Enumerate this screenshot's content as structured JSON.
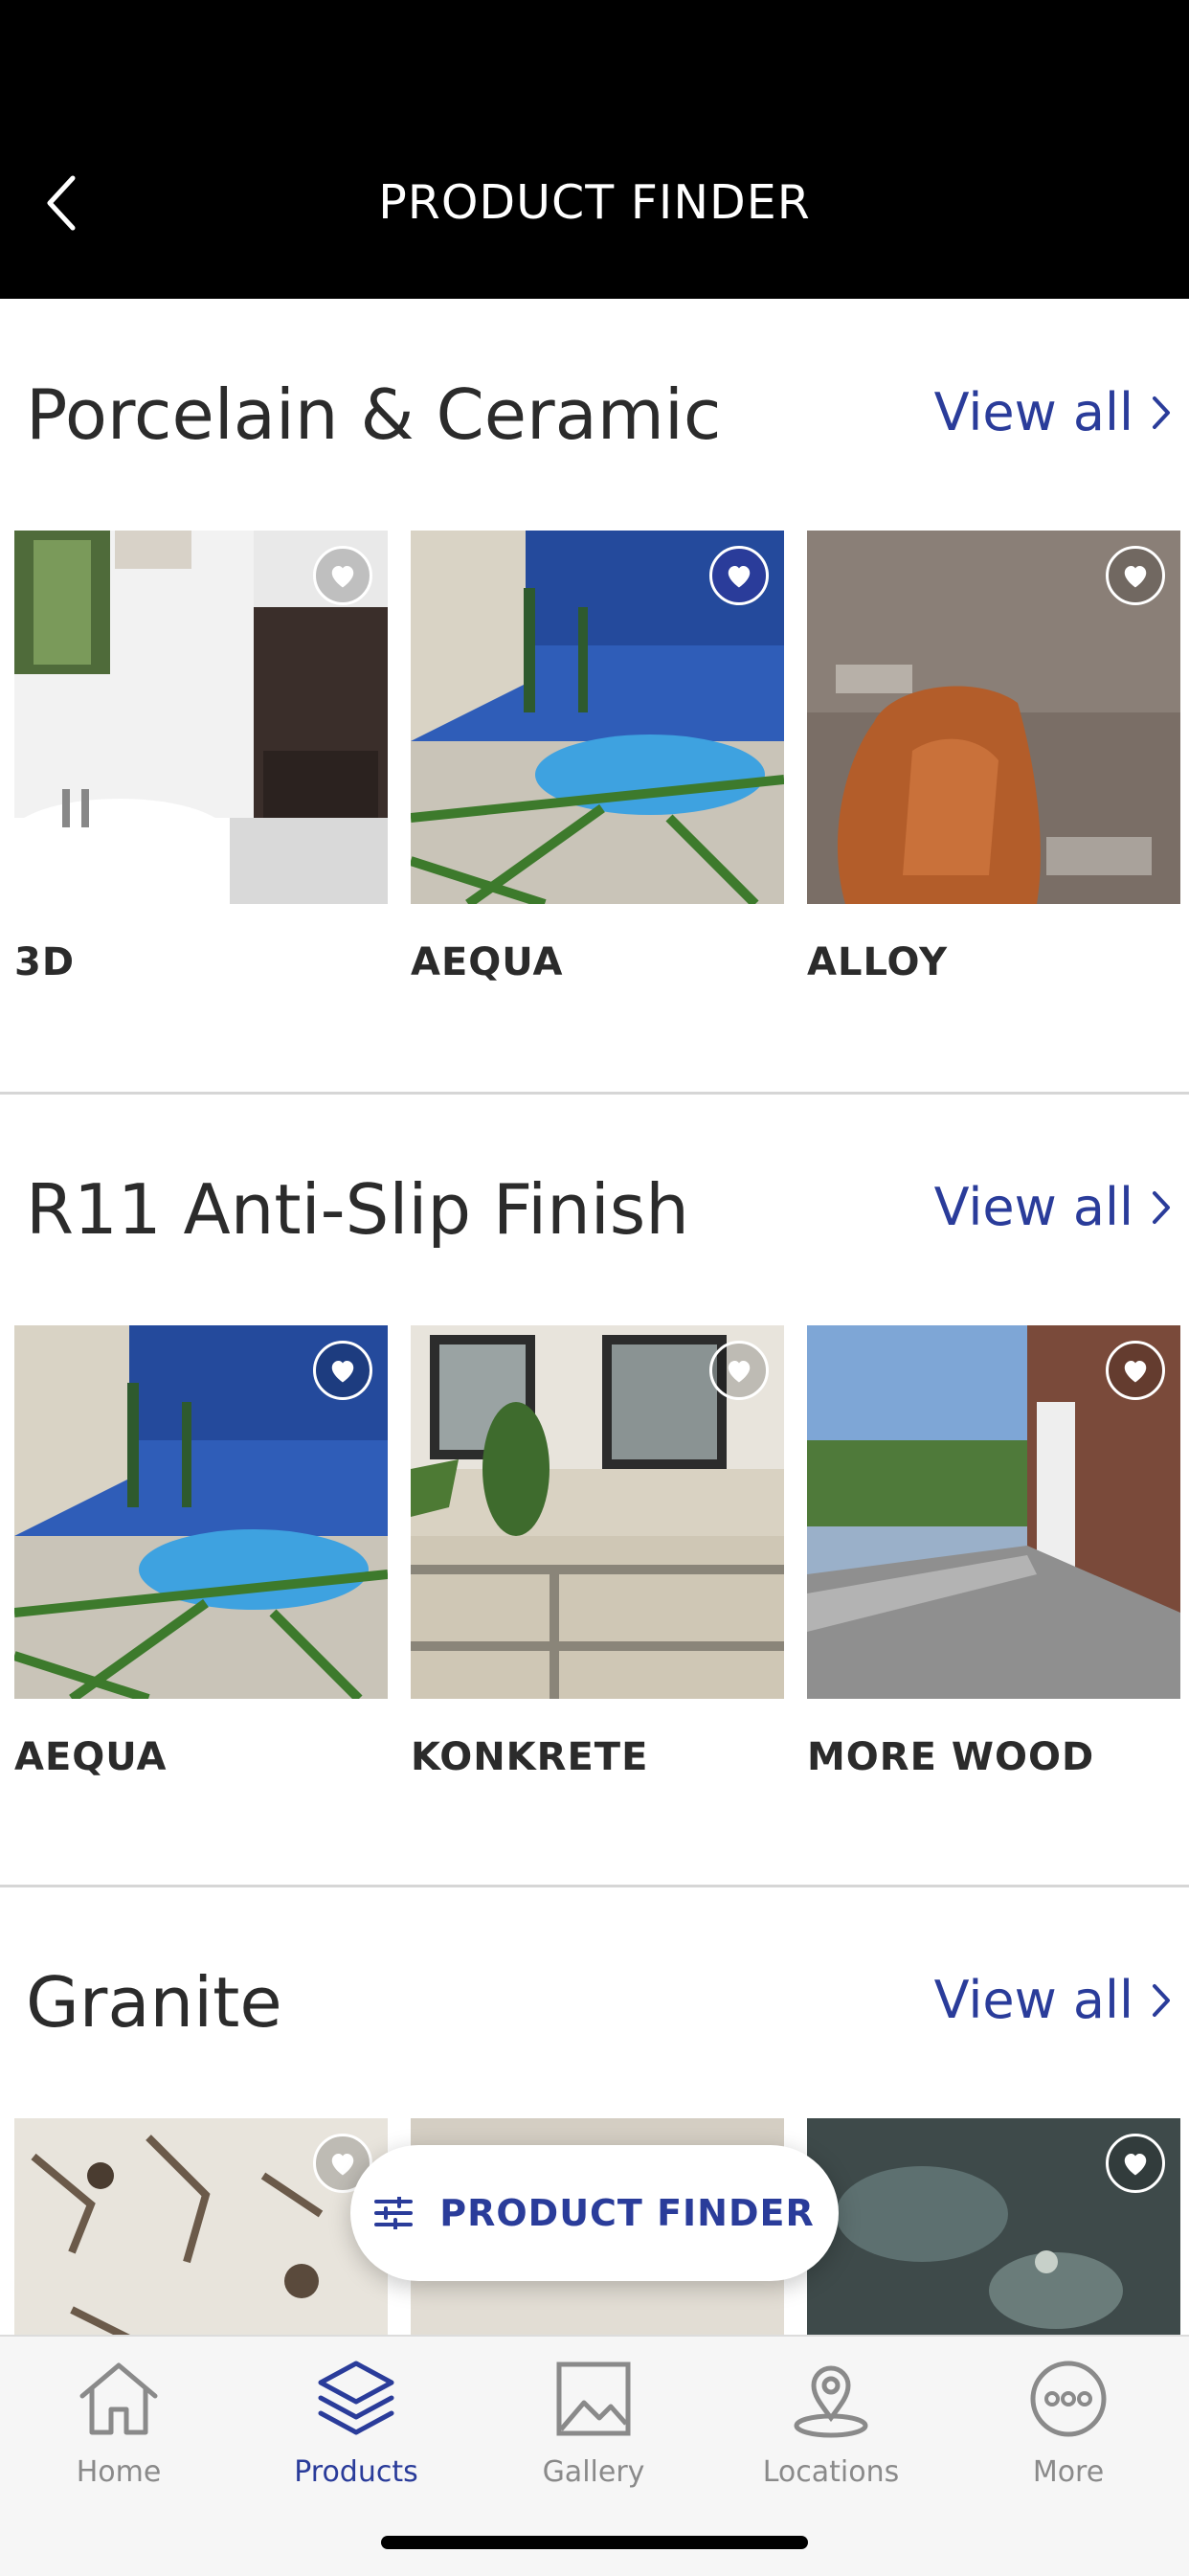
{
  "header": {
    "title": "PRODUCT FINDER"
  },
  "sections": [
    {
      "title": "Porcelain & Ceramic",
      "view_all": "View all",
      "items": [
        {
          "label": "3D",
          "favorite": false
        },
        {
          "label": "AEQUA",
          "favorite": true
        },
        {
          "label": "ALLOY",
          "favorite": false
        }
      ]
    },
    {
      "title": "R11 Anti-Slip Finish",
      "view_all": "View all",
      "items": [
        {
          "label": "AEQUA",
          "favorite": false
        },
        {
          "label": "KONKRETE",
          "favorite": false
        },
        {
          "label": "MORE WOOD",
          "favorite": false
        }
      ]
    },
    {
      "title": "Granite",
      "view_all": "View all",
      "items": [
        {
          "label": "",
          "favorite": false
        },
        {
          "label": "",
          "favorite": false
        },
        {
          "label": "",
          "favorite": false
        }
      ]
    }
  ],
  "fab": {
    "label": "PRODUCT FINDER",
    "icon": "sliders-icon"
  },
  "tabbar": {
    "items": [
      {
        "label": "Home",
        "icon": "home-icon",
        "active": false
      },
      {
        "label": "Products",
        "icon": "layers-icon",
        "active": true
      },
      {
        "label": "Gallery",
        "icon": "image-icon",
        "active": false
      },
      {
        "label": "Locations",
        "icon": "location-pin-icon",
        "active": false
      },
      {
        "label": "More",
        "icon": "more-icon",
        "active": false
      }
    ]
  },
  "colors": {
    "accent": "#2a3c9a",
    "header_bg": "#000000",
    "tab_inactive": "#8a8a8a"
  }
}
